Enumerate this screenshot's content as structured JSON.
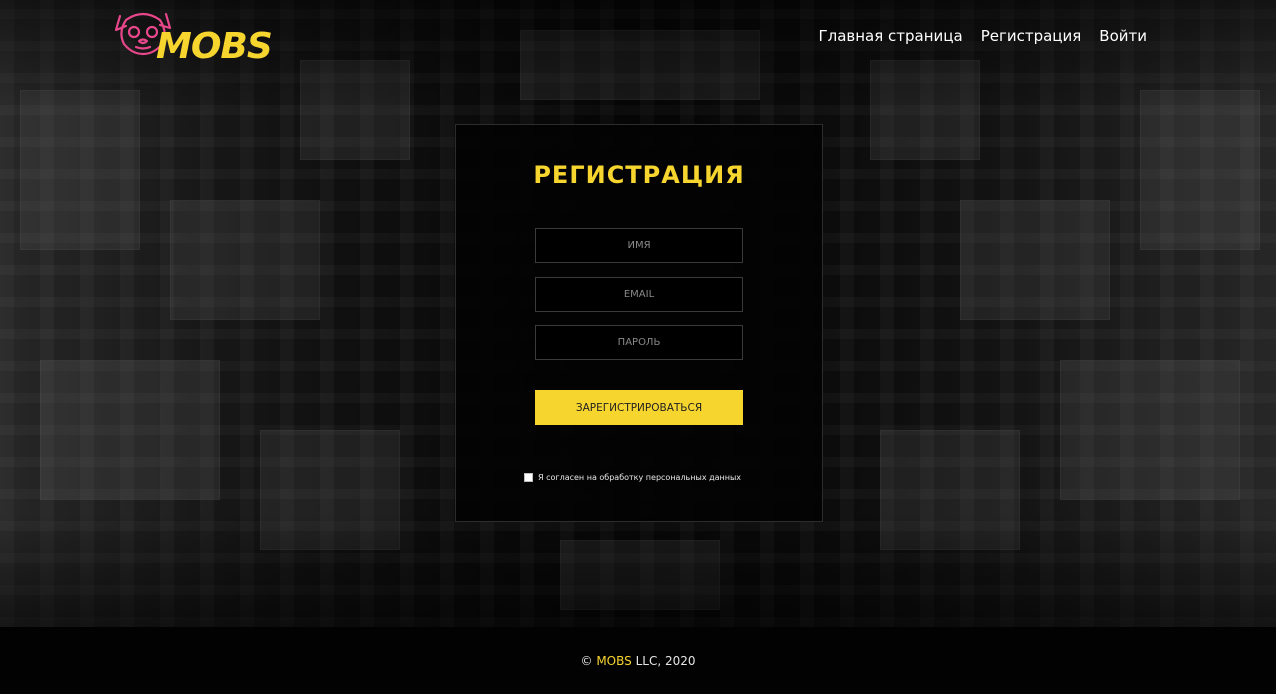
{
  "brand": {
    "logo_text": "MOBS",
    "accent_color": "#f7d52f",
    "logo_icon": "pug-face-icon",
    "icon_color": "#e8478b"
  },
  "nav": {
    "items": [
      {
        "label": "Главная страница"
      },
      {
        "label": "Регистрация"
      },
      {
        "label": "Войти"
      }
    ]
  },
  "form": {
    "title": "РЕГИСТРАЦИЯ",
    "name_placeholder": "имя",
    "email_placeholder": "EMAIL",
    "password_placeholder": "ПАРОЛЬ",
    "submit_label": "ЗАРЕГИСТРИРОВАТЬСЯ",
    "consent_label": "Я согласен на обработку персональных данных",
    "consent_checked": false
  },
  "footer": {
    "copyright_symbol": "©",
    "brand": "MOBS",
    "rest": "LLC, 2020"
  }
}
